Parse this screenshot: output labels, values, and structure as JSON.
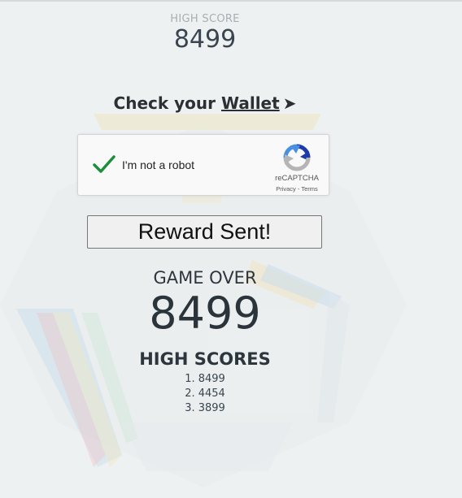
{
  "header": {
    "high_score_label": "HIGH SCORE",
    "high_score_value": "8499"
  },
  "wallet_prompt": {
    "prefix": "Check your ",
    "link": "Wallet",
    "arrow": "➤"
  },
  "captcha": {
    "checkbox_state": "checked",
    "label": "I'm not a robot",
    "brand": "reCAPTCHA",
    "privacy": "Privacy",
    "separator": " - ",
    "terms": "Terms"
  },
  "reward_button": {
    "label": "Reward Sent!"
  },
  "game_over": {
    "title": "GAME OVER",
    "score": "8499"
  },
  "high_scores": {
    "title": "HIGH SCORES",
    "entries": [
      "1. 8499",
      "2. 4454",
      "3. 3899"
    ]
  },
  "colors": {
    "background": "#eef1f2",
    "check_green": "#1e8e3e",
    "recaptcha_blue": "#1c3aa9",
    "recaptcha_lightblue": "#4a90e2",
    "recaptcha_gray": "#b5b5b5"
  }
}
